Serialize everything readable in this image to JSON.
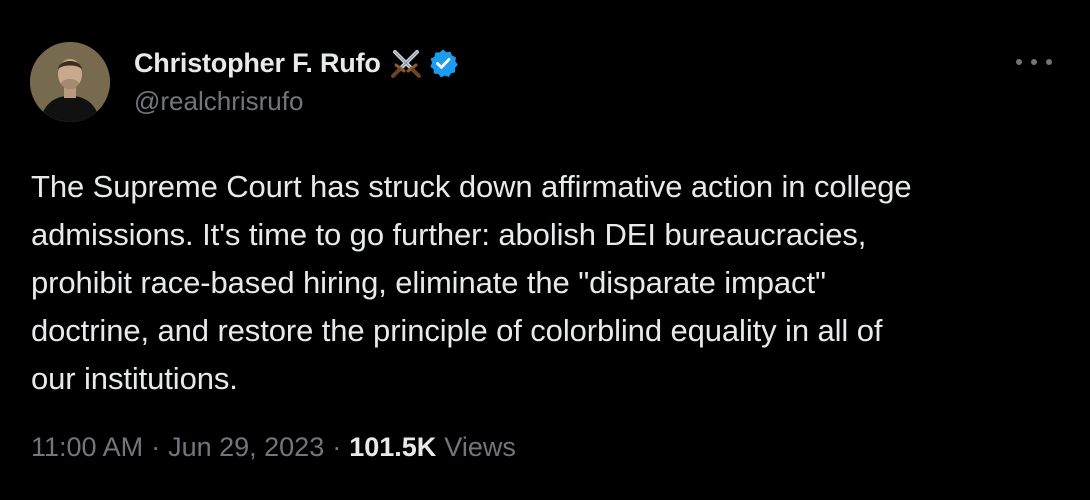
{
  "tweet": {
    "author": {
      "display_name": "Christopher F. Rufo",
      "handle": "@realchrisrufo",
      "name_emoji": "crossed-swords-icon",
      "verified_color": "#1d9bf0"
    },
    "text_lines": [
      "The Supreme Court has struck down affirmative action in college",
      "admissions. It's time to go further: abolish DEI bureaucracies,",
      "prohibit race-based hiring, eliminate the \"disparate impact\"",
      "doctrine, and restore the principle of colorblind equality in all of",
      "our institutions."
    ],
    "meta": {
      "time": "11:00 AM",
      "separator": "·",
      "date": "Jun 29, 2023",
      "views_count": "101.5K",
      "views_label": "Views"
    }
  },
  "colors": {
    "background": "#000000",
    "primary_text": "#e7e9ea",
    "secondary_text": "#71767b",
    "accent": "#1d9bf0"
  }
}
